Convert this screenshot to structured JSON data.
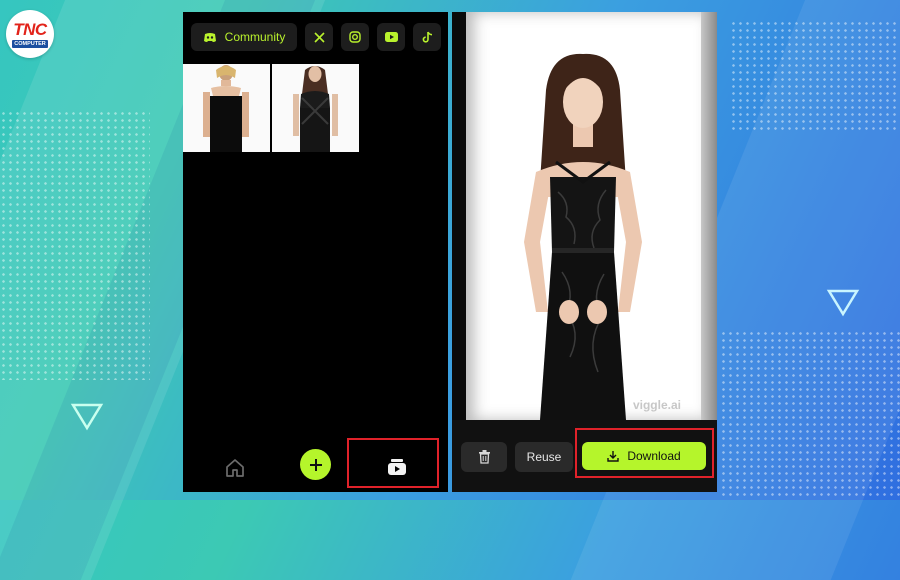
{
  "logo": {
    "main": "TNC",
    "sub": "COMPUTER"
  },
  "topbar": {
    "community_label": "Community",
    "icons": [
      "discord-icon",
      "x-icon",
      "instagram-icon",
      "youtube-icon",
      "tiktok-icon"
    ]
  },
  "gallery": {
    "thumbnails": [
      "black-dress-photo",
      "lace-dress-photo"
    ]
  },
  "bottom_nav": {
    "items": [
      "home-icon",
      "add-icon",
      "library-icon"
    ]
  },
  "preview": {
    "watermark": "viggle.ai"
  },
  "actions": {
    "reuse_label": "Reuse",
    "download_label": "Download"
  },
  "colors": {
    "accent": "#b5f52b",
    "highlight": "#e0222a",
    "panel_bg": "#000000"
  }
}
